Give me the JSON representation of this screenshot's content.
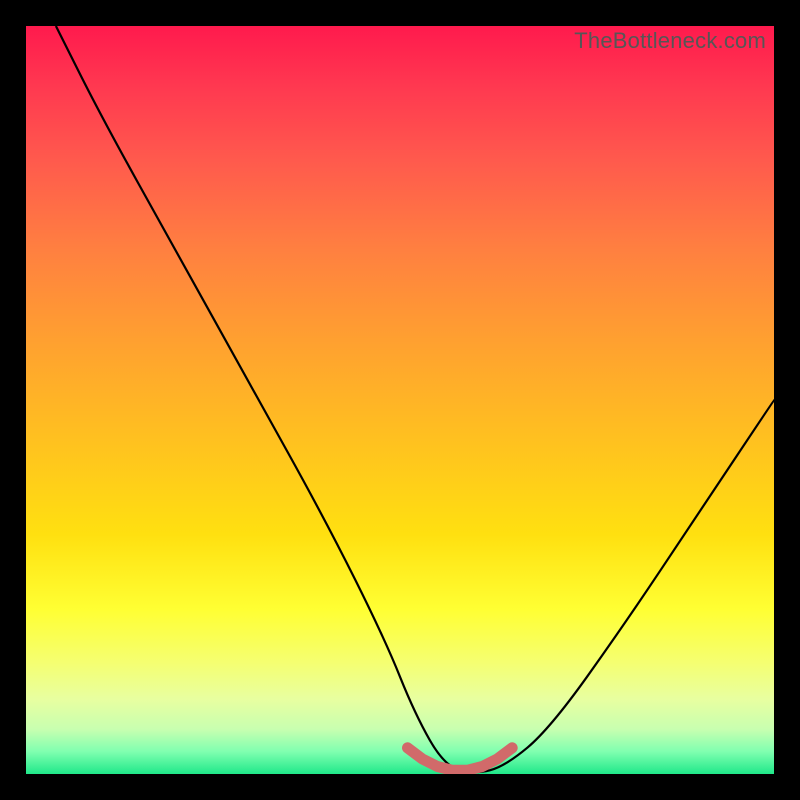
{
  "watermark": "TheBottleneck.com",
  "chart_data": {
    "type": "line",
    "title": "",
    "xlabel": "",
    "ylabel": "",
    "xlim": [
      0,
      100
    ],
    "ylim": [
      0,
      100
    ],
    "series": [
      {
        "name": "bottleneck-curve",
        "x": [
          4,
          10,
          20,
          30,
          40,
          48,
          52,
          56,
          60,
          64,
          70,
          80,
          90,
          100
        ],
        "values": [
          100,
          88,
          70,
          52,
          34,
          18,
          8,
          1,
          0,
          1,
          6,
          20,
          35,
          50
        ]
      }
    ],
    "annotations": [
      {
        "name": "min-band",
        "x": [
          51,
          53,
          55,
          57,
          59,
          61,
          63,
          65
        ],
        "values": [
          3.5,
          2.0,
          1.0,
          0.5,
          0.5,
          1.0,
          2.0,
          3.5
        ]
      }
    ],
    "colors": {
      "curve": "#000000",
      "min_band": "#d16a6a",
      "gradient_top": "#ff1a4d",
      "gradient_bottom": "#20e88a",
      "background": "#000000"
    }
  }
}
